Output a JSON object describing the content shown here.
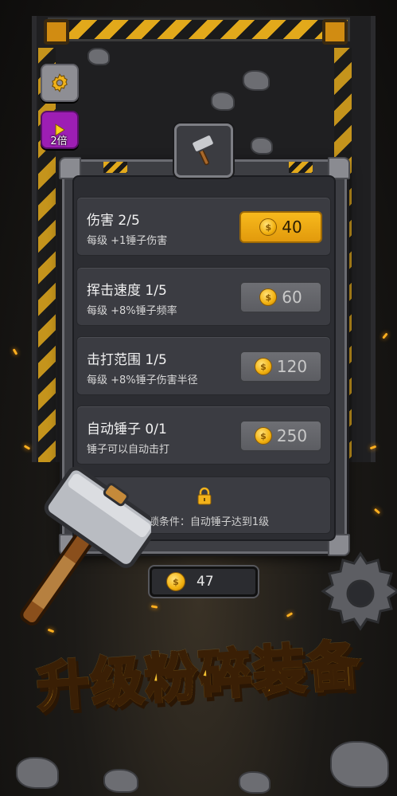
{
  "side_buttons": {
    "settings_icon": "gear-icon",
    "speed_icon": "play-icon",
    "speed_label": "2倍"
  },
  "panel": {
    "icon": "hammer-icon",
    "upgrades": [
      {
        "title": "伤害 2/5",
        "desc": "每级 +1锤子伤害",
        "price": "40",
        "state": "affordable"
      },
      {
        "title": "挥击速度 1/5",
        "desc": "每级 +8%锤子频率",
        "price": "60",
        "state": "unaffordable"
      },
      {
        "title": "击打范围 1/5",
        "desc": "每级 +8%锤子伤害半径",
        "price": "120",
        "state": "unaffordable"
      },
      {
        "title": "自动锤子 0/1",
        "desc": "锤子可以自动击打",
        "price": "250",
        "state": "unaffordable"
      }
    ],
    "locked": {
      "icon": "lock-icon",
      "text": "解锁条件：自动锤子达到1级"
    }
  },
  "wallet": {
    "icon": "coin-icon",
    "coins": "47"
  },
  "banner": "升级粉碎装备",
  "colors": {
    "accent": "#f5b418",
    "panel": "#2c2d32",
    "row": "#3b3c42",
    "speed_button": "#9d1eb4"
  }
}
